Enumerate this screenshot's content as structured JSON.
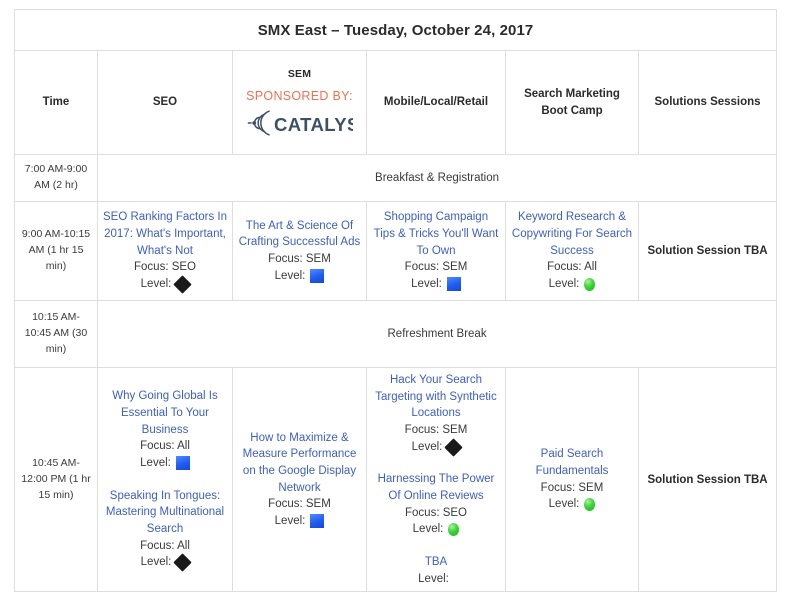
{
  "table": {
    "title": "SMX East – Tuesday, October 24, 2017",
    "columns": [
      {
        "label": "Time"
      },
      {
        "label": "SEO"
      },
      {
        "label": "SEM",
        "sponsored_label": "SPONSORED BY:",
        "sponsor_name": "CATALYST"
      },
      {
        "label": "Mobile/Local/Retail"
      },
      {
        "label": "Search Marketing Boot Camp"
      },
      {
        "label": "Solutions Sessions"
      }
    ],
    "level_legend": {
      "beginner": "green-circle",
      "intermediate": "blue-square",
      "advanced": "black-diamond"
    },
    "rows": [
      {
        "kind": "full",
        "time": "7:00 AM-9:00 AM (2 hr)",
        "full_text": "Breakfast & Registration"
      },
      {
        "kind": "sessions",
        "time": "9:00 AM-10:15 AM (1 hr 15 min)",
        "seo": [
          {
            "title": "SEO Ranking Factors In 2017: What's Important, What's Not",
            "focus": "Focus: SEO",
            "level_label": "Level:",
            "level": "advanced"
          }
        ],
        "sem": [
          {
            "title": "The Art & Science Of Crafting Successful Ads",
            "focus": "Focus: SEM",
            "level_label": "Level:",
            "level": "intermediate"
          }
        ],
        "mobile": [
          {
            "title": "Shopping Campaign Tips & Tricks You'll Want To Own",
            "focus": "Focus: SEM",
            "level_label": "Level:",
            "level": "intermediate"
          }
        ],
        "boot": [
          {
            "title": "Keyword Research & Copywriting For Search Success",
            "focus": "Focus: All",
            "level_label": "Level:",
            "level": "beginner"
          }
        ],
        "solutions": "Solution Session TBA"
      },
      {
        "kind": "full",
        "time": "10:15 AM-10:45 AM (30 min)",
        "full_text": "Refreshment Break"
      },
      {
        "kind": "sessions",
        "time": "10:45 AM-12:00 PM (1 hr 15 min)",
        "seo": [
          {
            "title": "Why Going Global Is Essential To Your Business",
            "focus": "Focus: All",
            "level_label": "Level:",
            "level": "intermediate"
          },
          {
            "title": "Speaking In Tongues: Mastering Multinational Search",
            "focus": "Focus: All",
            "level_label": "Level:",
            "level": "advanced"
          }
        ],
        "sem": [
          {
            "title": "How to Maximize & Measure Performance on the Google Display Network",
            "focus": "Focus: SEM",
            "level_label": "Level:",
            "level": "intermediate"
          }
        ],
        "mobile": [
          {
            "title": "Hack Your Search Targeting with Synthetic Locations",
            "focus": "Focus: SEM",
            "level_label": "Level:",
            "level": "advanced"
          },
          {
            "title": "Harnessing The Power Of Online Reviews",
            "focus": "Focus: SEO",
            "level_label": "Level:",
            "level": "beginner"
          },
          {
            "title": "TBA",
            "focus": "",
            "level_label": "Level:",
            "level": "none"
          }
        ],
        "boot": [
          {
            "title": "Paid Search Fundamentals",
            "focus": "Focus: SEM",
            "level_label": "Level:",
            "level": "beginner"
          }
        ],
        "solutions": "Solution Session TBA"
      }
    ]
  },
  "colors": {
    "link_blue": "#3d5fc4",
    "sponsor_orange": "#f2704f",
    "logo_slate": "#3d5068",
    "level_beginner": "#2ecc2e",
    "level_intermediate": "#2563f0",
    "level_advanced": "#1a1a1a",
    "border": "#dedede"
  }
}
